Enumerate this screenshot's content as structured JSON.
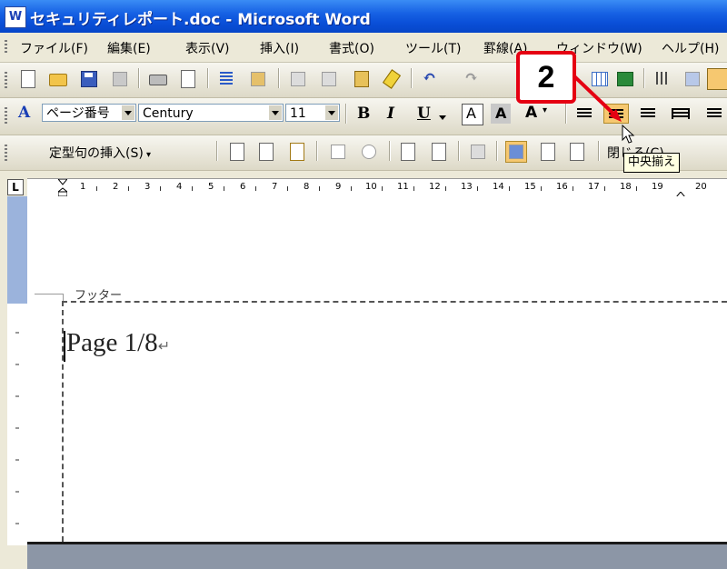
{
  "window": {
    "title": "セキュリティレポート.doc - Microsoft Word",
    "app_icon": "W"
  },
  "menu": {
    "items": [
      {
        "label": "ファイル(F)"
      },
      {
        "label": "編集(E)"
      },
      {
        "label": "表示(V)"
      },
      {
        "label": "挿入(I)"
      },
      {
        "label": "書式(O)"
      },
      {
        "label": "ツール(T)"
      },
      {
        "label": "罫線(A)"
      },
      {
        "label": "ウィンドウ(W)"
      },
      {
        "label": "ヘルプ(H)"
      }
    ]
  },
  "standard_toolbar": {
    "icons": [
      "new-document-icon",
      "open-folder-icon",
      "save-icon",
      "permission-icon",
      "print-icon",
      "print-preview-icon",
      "spelling-icon",
      "research-icon",
      "cut-icon",
      "copy-icon",
      "paste-icon",
      "format-painter-icon",
      "undo-icon",
      "redo-icon",
      "insert-table-icon",
      "insert-excel-icon",
      "columns-icon",
      "drawing-icon"
    ]
  },
  "format_toolbar": {
    "style_value": "ページ番号",
    "font_value": "Century",
    "size_value": "11",
    "bold_label": "B",
    "italic_label": "I",
    "underline_label": "U",
    "char_border_label": "A",
    "char_shading_label": "A",
    "scale_label": "A"
  },
  "header_footer_toolbar": {
    "insert_autotext_label": "定型句の挿入(S)",
    "close_label": "閉じる(C)"
  },
  "ruler": {
    "tab_label": "L",
    "numbers": [
      "1",
      "2",
      "3",
      "4",
      "5",
      "6",
      "7",
      "8",
      "9",
      "10",
      "11",
      "12",
      "13",
      "14",
      "15",
      "16",
      "17",
      "18",
      "19",
      "20"
    ]
  },
  "document": {
    "footer_label": "フッター",
    "footer_text": "Page 1/8",
    "paragraph_mark": "↵"
  },
  "callout": {
    "number": "2"
  },
  "tooltip": {
    "text": "中央揃え"
  },
  "colors": {
    "titlebar": "#0a4fd8",
    "callout_border": "#e50012",
    "tooltip_bg": "#ffffe1",
    "selected_button": "#f6c870"
  }
}
